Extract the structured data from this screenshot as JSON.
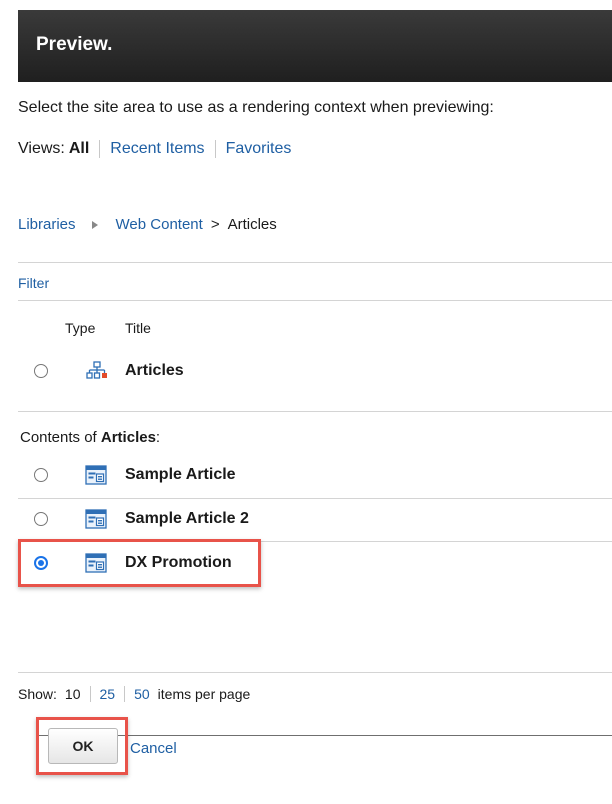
{
  "header": {
    "title": "Preview."
  },
  "instructions": "Select the site area to use as a rendering context when previewing:",
  "views": {
    "label": "Views:",
    "all": "All",
    "recent": "Recent Items",
    "favorites": "Favorites"
  },
  "breadcrumb": {
    "libraries": "Libraries",
    "web_content": "Web Content",
    "separator": ">",
    "current": "Articles"
  },
  "filter_label": "Filter",
  "columns": {
    "type": "Type",
    "title": "Title"
  },
  "site_area": {
    "title": "Articles",
    "icon": "site-area-icon",
    "selected": false
  },
  "contents": {
    "prefix": "Contents of ",
    "name": "Articles",
    "suffix": ":"
  },
  "items": [
    {
      "title": "Sample Article",
      "icon": "content-item-icon",
      "selected": false
    },
    {
      "title": "Sample Article 2",
      "icon": "content-item-icon",
      "selected": false
    },
    {
      "title": "DX Promotion",
      "icon": "content-item-icon",
      "selected": true
    }
  ],
  "pagination": {
    "label": "Show:",
    "options": [
      "10",
      "25",
      "50"
    ],
    "current": "10",
    "suffix": "items per page"
  },
  "buttons": {
    "ok": "OK",
    "cancel": "Cancel"
  },
  "colors": {
    "header_bg": "#2a2a2a",
    "link": "#1f5fa3",
    "highlight": "#e8534a",
    "radio_selected": "#1a73e8"
  }
}
